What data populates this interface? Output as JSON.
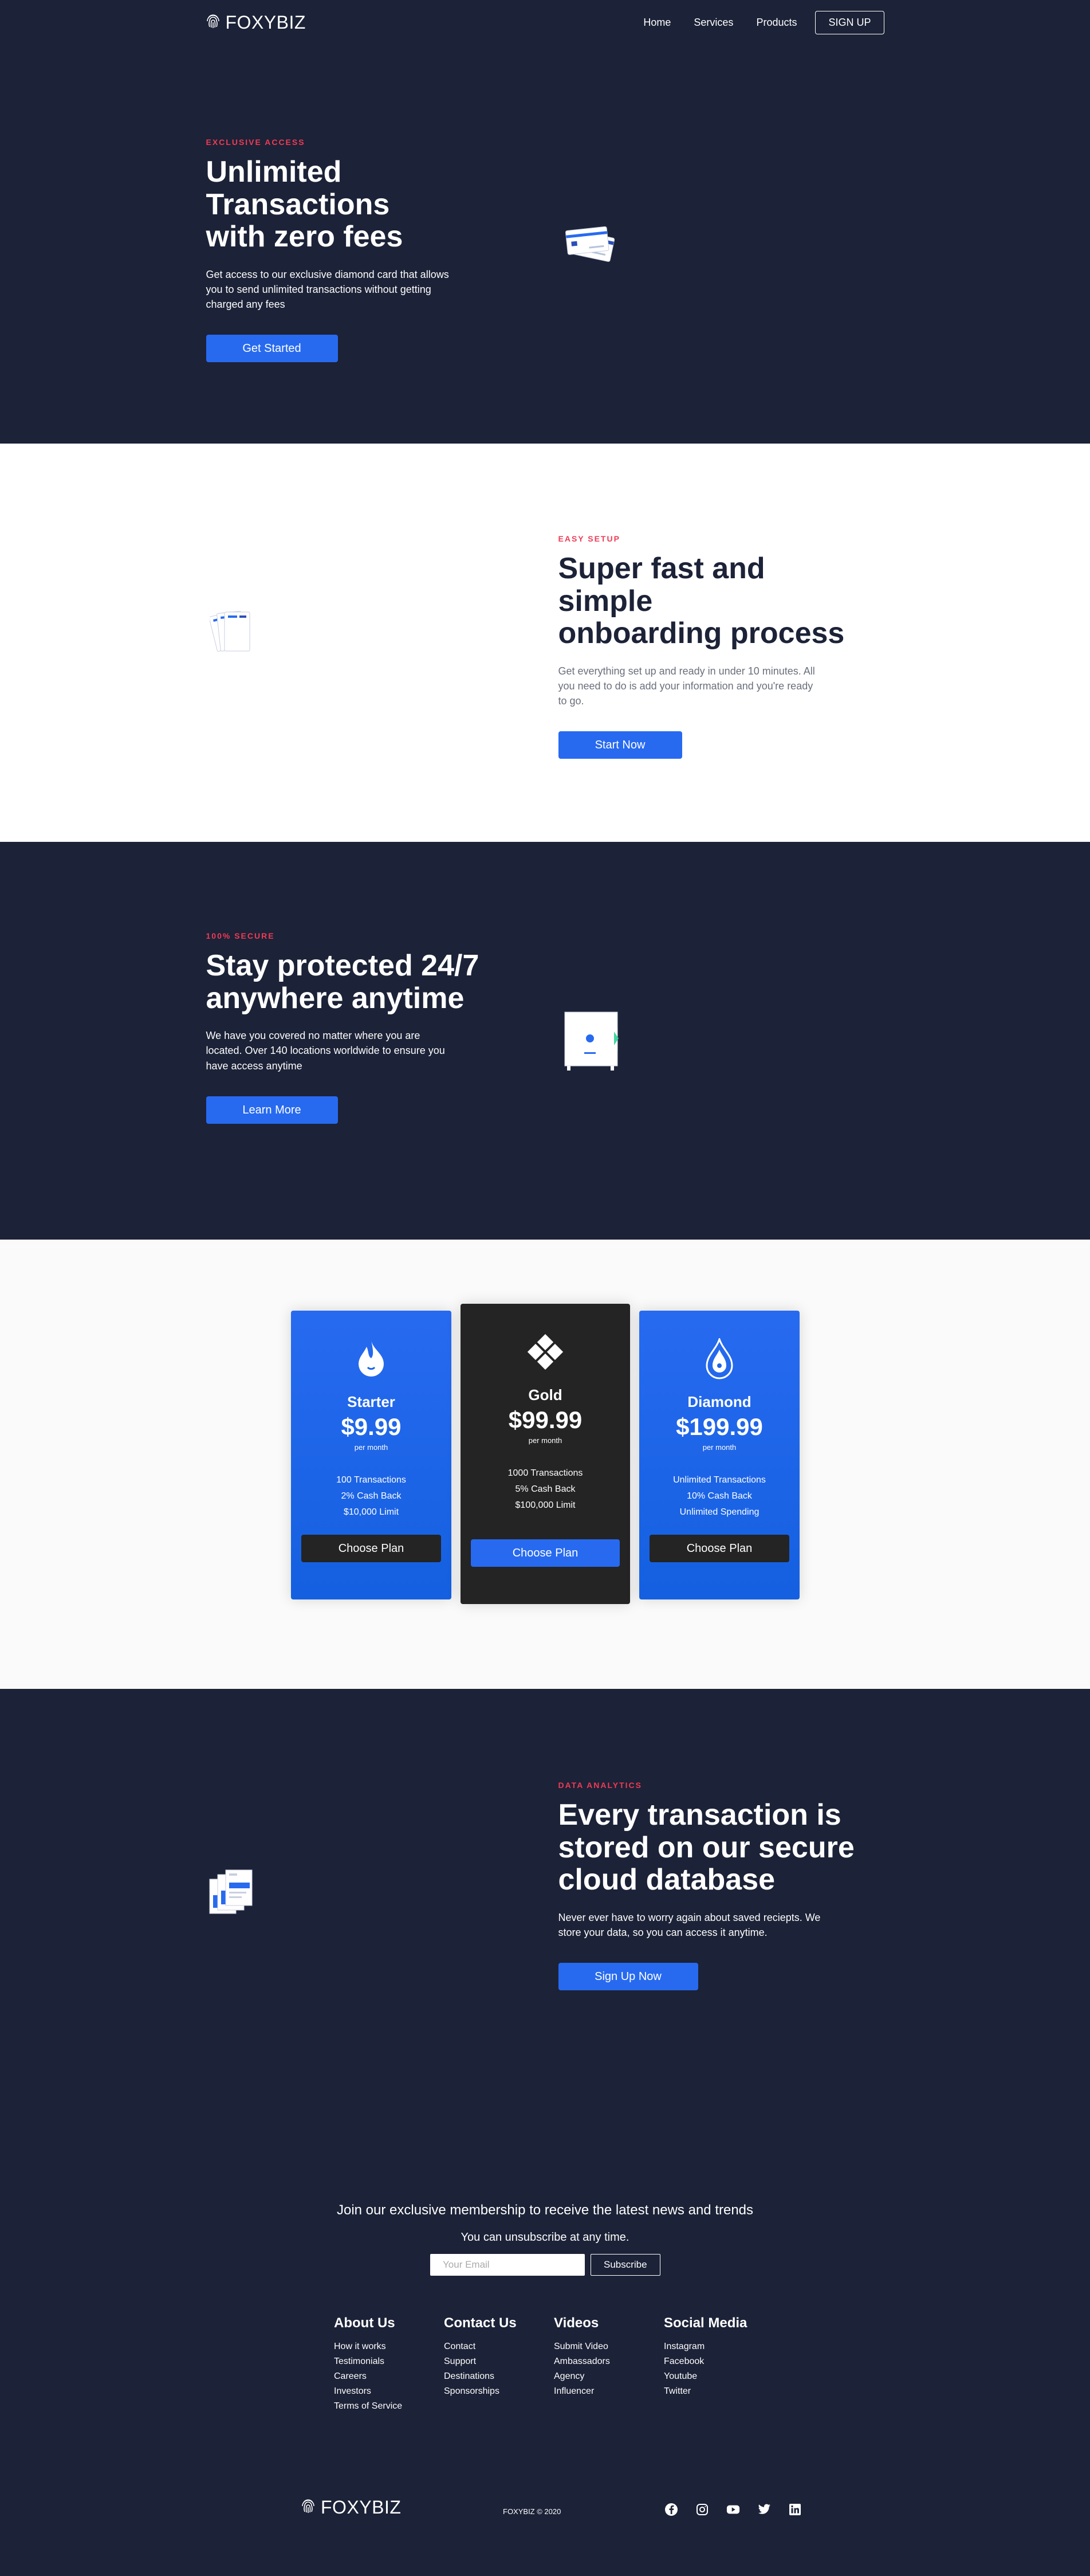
{
  "nav": {
    "logo": "FOXYBIZ",
    "links": [
      "Home",
      "Services",
      "Products"
    ],
    "signup": "SIGN UP"
  },
  "hero": {
    "eyebrow": "EXCLUSIVE ACCESS",
    "heading_line1": "Unlimited Transactions",
    "heading_line2": "with zero fees",
    "desc": "Get access to our exclusive diamond card that allows you to send unlimited transactions without getting charged any fees",
    "button": "Get Started"
  },
  "onboarding": {
    "eyebrow": "EASY SETUP",
    "heading_line1": "Super fast and simple",
    "heading_line2": "onboarding process",
    "desc": "Get everything set up and ready in under 10 minutes. All you need to do is add your information and you're ready to go.",
    "button": "Start Now"
  },
  "secure": {
    "eyebrow": "100% SECURE",
    "heading_line1": "Stay protected 24/7",
    "heading_line2": "anywhere anytime",
    "desc": "We have you covered no matter where you are located. Over 140 locations worldwide to ensure you have access anytime",
    "button": "Learn More"
  },
  "pricing": {
    "plans": [
      {
        "name": "Starter",
        "price": "$9.99",
        "per": "per month",
        "features": [
          "100 Transactions",
          "2% Cash Back",
          "$10,000 Limit"
        ],
        "button": "Choose Plan",
        "icon": "fire-icon"
      },
      {
        "name": "Gold",
        "price": "$99.99",
        "per": "per month",
        "features": [
          "1000 Transactions",
          "5% Cash Back",
          "$100,000 Limit"
        ],
        "button": "Choose Plan",
        "icon": "gem-icon"
      },
      {
        "name": "Diamond",
        "price": "$199.99",
        "per": "per month",
        "features": [
          "Unlimited Transactions",
          "10% Cash Back",
          "Unlimited Spending"
        ],
        "button": "Choose Plan",
        "icon": "crystal-icon"
      }
    ]
  },
  "analytics": {
    "eyebrow": "DATA ANALYTICS",
    "heading_line1": "Every transaction is",
    "heading_line2": "stored on our secure",
    "heading_line3": "cloud database",
    "desc": "Never ever have to worry again about saved reciepts. We store your data, so you can access it anytime.",
    "button": "Sign Up Now"
  },
  "newsletter": {
    "title": "Join our exclusive membership to receive the latest news and trends",
    "subtitle": "You can unsubscribe at any time.",
    "placeholder": "Your Email",
    "button": "Subscribe"
  },
  "footer": {
    "columns": [
      {
        "title": "About Us",
        "links": [
          "How it works",
          "Testimonials",
          "Careers",
          "Investors",
          "Terms of Service"
        ]
      },
      {
        "title": "Contact Us",
        "links": [
          "Contact",
          "Support",
          "Destinations",
          "Sponsorships"
        ]
      },
      {
        "title": "Videos",
        "links": [
          "Submit Video",
          "Ambassadors",
          "Agency",
          "Influencer"
        ]
      },
      {
        "title": "Social Media",
        "links": [
          "Instagram",
          "Facebook",
          "Youtube",
          "Twitter"
        ]
      }
    ],
    "logo": "FOXYBIZ",
    "copyright": "FOXYBIZ © 2020",
    "socials": [
      "facebook-icon",
      "instagram-icon",
      "youtube-icon",
      "twitter-icon",
      "linkedin-icon"
    ]
  },
  "colors": {
    "navy": "#1c2237",
    "accent_blue": "#276af0",
    "eyebrow_red": "#ef3b55",
    "card_black": "#242424",
    "pricing_bg": "#fafafa"
  }
}
